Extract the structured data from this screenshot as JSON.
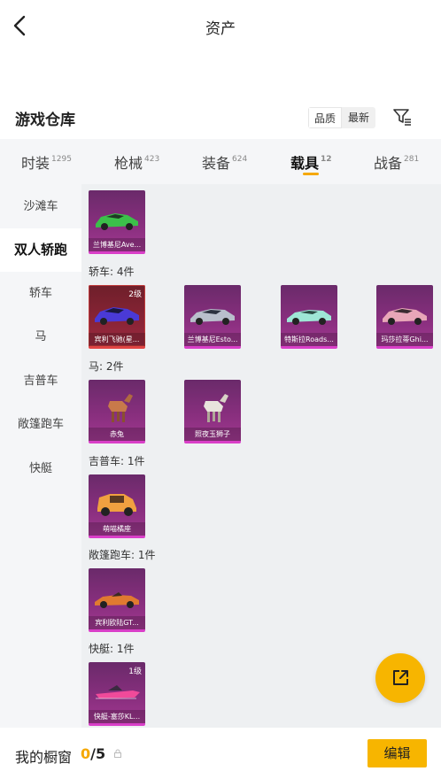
{
  "header": {
    "title": "资产"
  },
  "warehouse": {
    "title": "游戏仓库",
    "sort_quality": "品质",
    "sort_newest": "最新"
  },
  "tabs": [
    {
      "label": "时装",
      "count": "1295"
    },
    {
      "label": "枪械",
      "count": "423"
    },
    {
      "label": "装备",
      "count": "624"
    },
    {
      "label": "载具",
      "count": "12"
    },
    {
      "label": "战备",
      "count": "281"
    }
  ],
  "sidebar": {
    "items": [
      "沙滩车",
      "双人轿跑",
      "轿车",
      "马",
      "吉普车",
      "敞篷跑车",
      "快艇"
    ]
  },
  "sections": {
    "top": {
      "items": [
        {
          "name": "兰博基尼Ave..."
        }
      ]
    },
    "sedan": {
      "label": "轿车: 4件",
      "items": [
        {
          "name": "宾利飞驰(星...",
          "level": "2级"
        },
        {
          "name": "兰博基尼Esto..."
        },
        {
          "name": "特斯拉Roads..."
        },
        {
          "name": "玛莎拉蒂Ghi..."
        }
      ]
    },
    "horse": {
      "label": "马: 2件",
      "items": [
        {
          "name": "赤兔"
        },
        {
          "name": "照夜玉狮子"
        }
      ]
    },
    "jeep": {
      "label": "吉普车: 1件",
      "items": [
        {
          "name": "萌喵橘座"
        }
      ]
    },
    "convertible": {
      "label": "敞篷跑车: 1件",
      "items": [
        {
          "name": "宾利欧陆GT..."
        }
      ]
    },
    "boat": {
      "label": "快艇: 1件",
      "items": [
        {
          "name": "快艇-塞莎KL...",
          "level": "1级"
        }
      ]
    }
  },
  "bottom": {
    "label": "我的橱窗",
    "current": "0",
    "total": "/5",
    "edit": "编辑"
  },
  "colors": {
    "accent": "#f7b500",
    "card_purple": "#8a2f7f",
    "card_red": "#8a2436"
  }
}
